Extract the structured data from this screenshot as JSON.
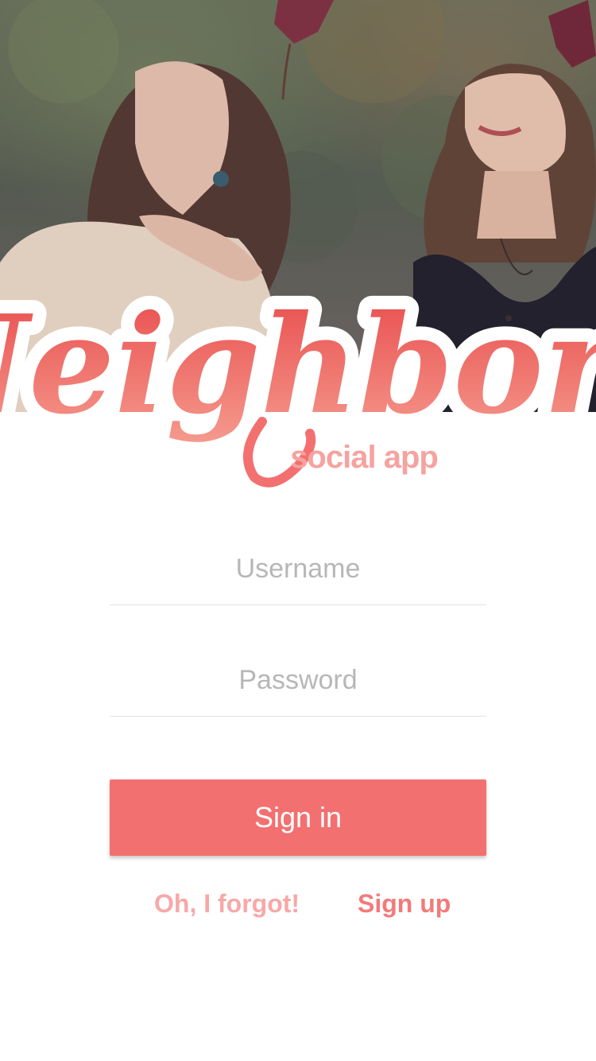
{
  "colors": {
    "accent": "#f37070",
    "link_primary": "#f37a7a",
    "link_secondary": "#f7a8a8",
    "placeholder": "#b7b7b7",
    "divider": "#e2e2e2"
  },
  "hero": {
    "image_subject": "two women looking up at falling autumn leaves"
  },
  "logo": {
    "title": "Neighbors",
    "subtitle": "social app"
  },
  "form": {
    "username": {
      "placeholder": "Username",
      "value": ""
    },
    "password": {
      "placeholder": "Password",
      "value": ""
    },
    "signin_label": "Sign in"
  },
  "links": {
    "forgot_label": "Oh, I forgot!",
    "signup_label": "Sign up"
  }
}
